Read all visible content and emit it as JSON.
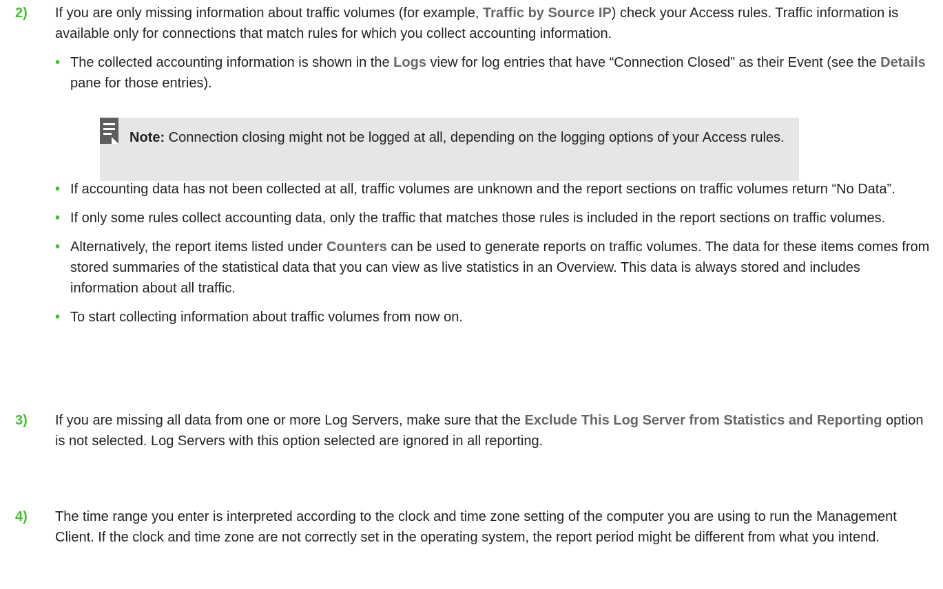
{
  "steps": [
    {
      "number": "2)",
      "intro": {
        "t1": "If you are only missing information about traffic volumes (for example, ",
        "b1": "Traffic by Source IP",
        "t2": ") check your Access rules. Traffic information is available only for connections that match rules for which you collect accounting information."
      },
      "bullets": [
        {
          "t1": "The collected accounting information is shown in the ",
          "b1": "Logs",
          "t2": " view for log entries that have “Connection Closed” as their Event (see the ",
          "b2": "Details",
          "t3": " pane for those entries)."
        },
        {
          "text": "If accounting data has not been collected at all, traffic volumes are unknown and the report sections on traffic volumes return “No Data”."
        },
        {
          "text": "If only some rules collect accounting data, only the traffic that matches those rules is included in the report sections on traffic volumes."
        },
        {
          "t1": "Alternatively, the report items listed under ",
          "b1": "Counters",
          "t2": " can be used to generate reports on traffic volumes. The data for these items comes from stored summaries of the statistical data that you can view as live statistics in an Overview. This data is always stored and includes information about all traffic."
        },
        {
          "text": "To start collecting information about traffic volumes from now on."
        }
      ]
    },
    {
      "number": "3)",
      "t1": "If you are missing all data from one or more Log Servers, make sure that the ",
      "b1": "Exclude This Log Server from Statistics and Reporting",
      "t2": " option is not selected. Log Servers with this option selected are ignored in all reporting."
    },
    {
      "number": "4)",
      "text": "The time range you enter is interpreted according to the clock and time zone setting of the computer you are using to run the Management Client. If the clock and time zone are not correctly set in the operating system, the report period might be different from what you intend."
    }
  ],
  "note": {
    "icon": "note-icon",
    "label": "Note:",
    "text": " Connection closing might not be logged at all, depending on the logging options of your Access rules."
  },
  "bullet_glyph": "•",
  "colors": {
    "accent_green": "#4cb93a",
    "ui_term_gray": "#666666",
    "note_background": "#e6e6e6",
    "note_icon": "#5d5d5d",
    "text": "#222222"
  }
}
